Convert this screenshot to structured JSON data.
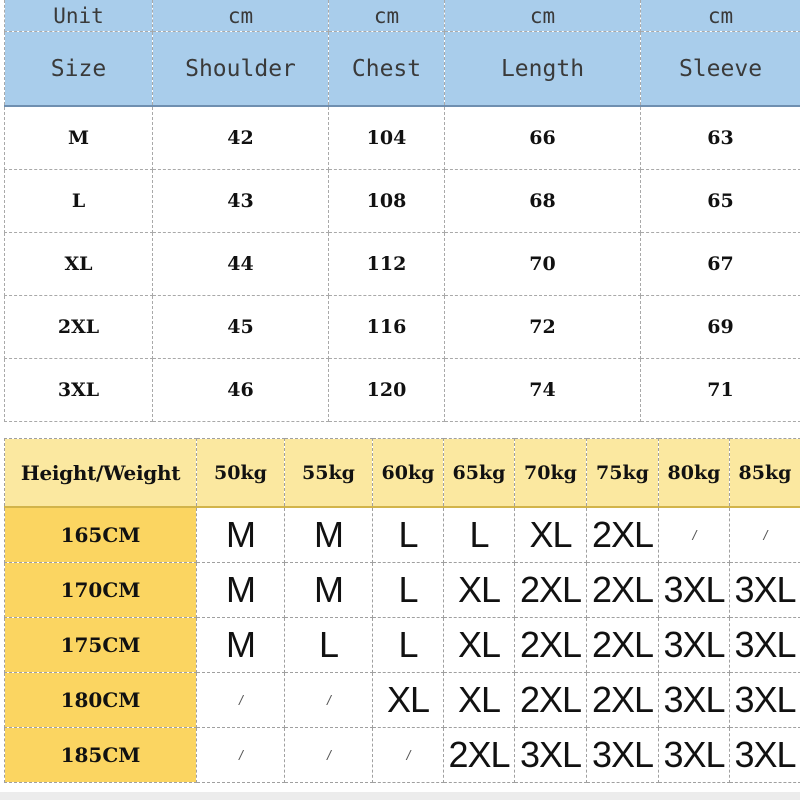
{
  "size_chart": {
    "unit_row": {
      "label": "Unit",
      "units": [
        "cm",
        "cm",
        "cm",
        "cm"
      ]
    },
    "headers": [
      "Size",
      "Shoulder",
      "Chest",
      "Length",
      "Sleeve"
    ],
    "rows": [
      {
        "size": "M",
        "values": [
          "42",
          "104",
          "66",
          "63"
        ]
      },
      {
        "size": "L",
        "values": [
          "43",
          "108",
          "68",
          "65"
        ]
      },
      {
        "size": "XL",
        "values": [
          "44",
          "112",
          "70",
          "67"
        ]
      },
      {
        "size": "2XL",
        "values": [
          "45",
          "116",
          "72",
          "69"
        ]
      },
      {
        "size": "3XL",
        "values": [
          "46",
          "120",
          "74",
          "71"
        ]
      }
    ]
  },
  "recommendation_chart": {
    "corner_label": "Height/Weight",
    "weights": [
      "50kg",
      "55kg",
      "60kg",
      "65kg",
      "70kg",
      "75kg",
      "80kg",
      "85kg"
    ],
    "rows": [
      {
        "height": "165CM",
        "sizes": [
          "M",
          "M",
          "L",
          "L",
          "XL",
          "2XL",
          "/",
          "/"
        ]
      },
      {
        "height": "170CM",
        "sizes": [
          "M",
          "M",
          "L",
          "XL",
          "2XL",
          "2XL",
          "3XL",
          "3XL"
        ]
      },
      {
        "height": "175CM",
        "sizes": [
          "M",
          "L",
          "L",
          "XL",
          "2XL",
          "2XL",
          "3XL",
          "3XL"
        ]
      },
      {
        "height": "180CM",
        "sizes": [
          "/",
          "/",
          "XL",
          "XL",
          "2XL",
          "2XL",
          "3XL",
          "3XL"
        ]
      },
      {
        "height": "185CM",
        "sizes": [
          "/",
          "/",
          "/",
          "2XL",
          "3XL",
          "3XL",
          "3XL",
          "3XL"
        ]
      }
    ]
  },
  "colors": {
    "measurement_header": "#a9cdeb",
    "weight_header": "#fbe8a0",
    "height_column": "#fbd561"
  }
}
